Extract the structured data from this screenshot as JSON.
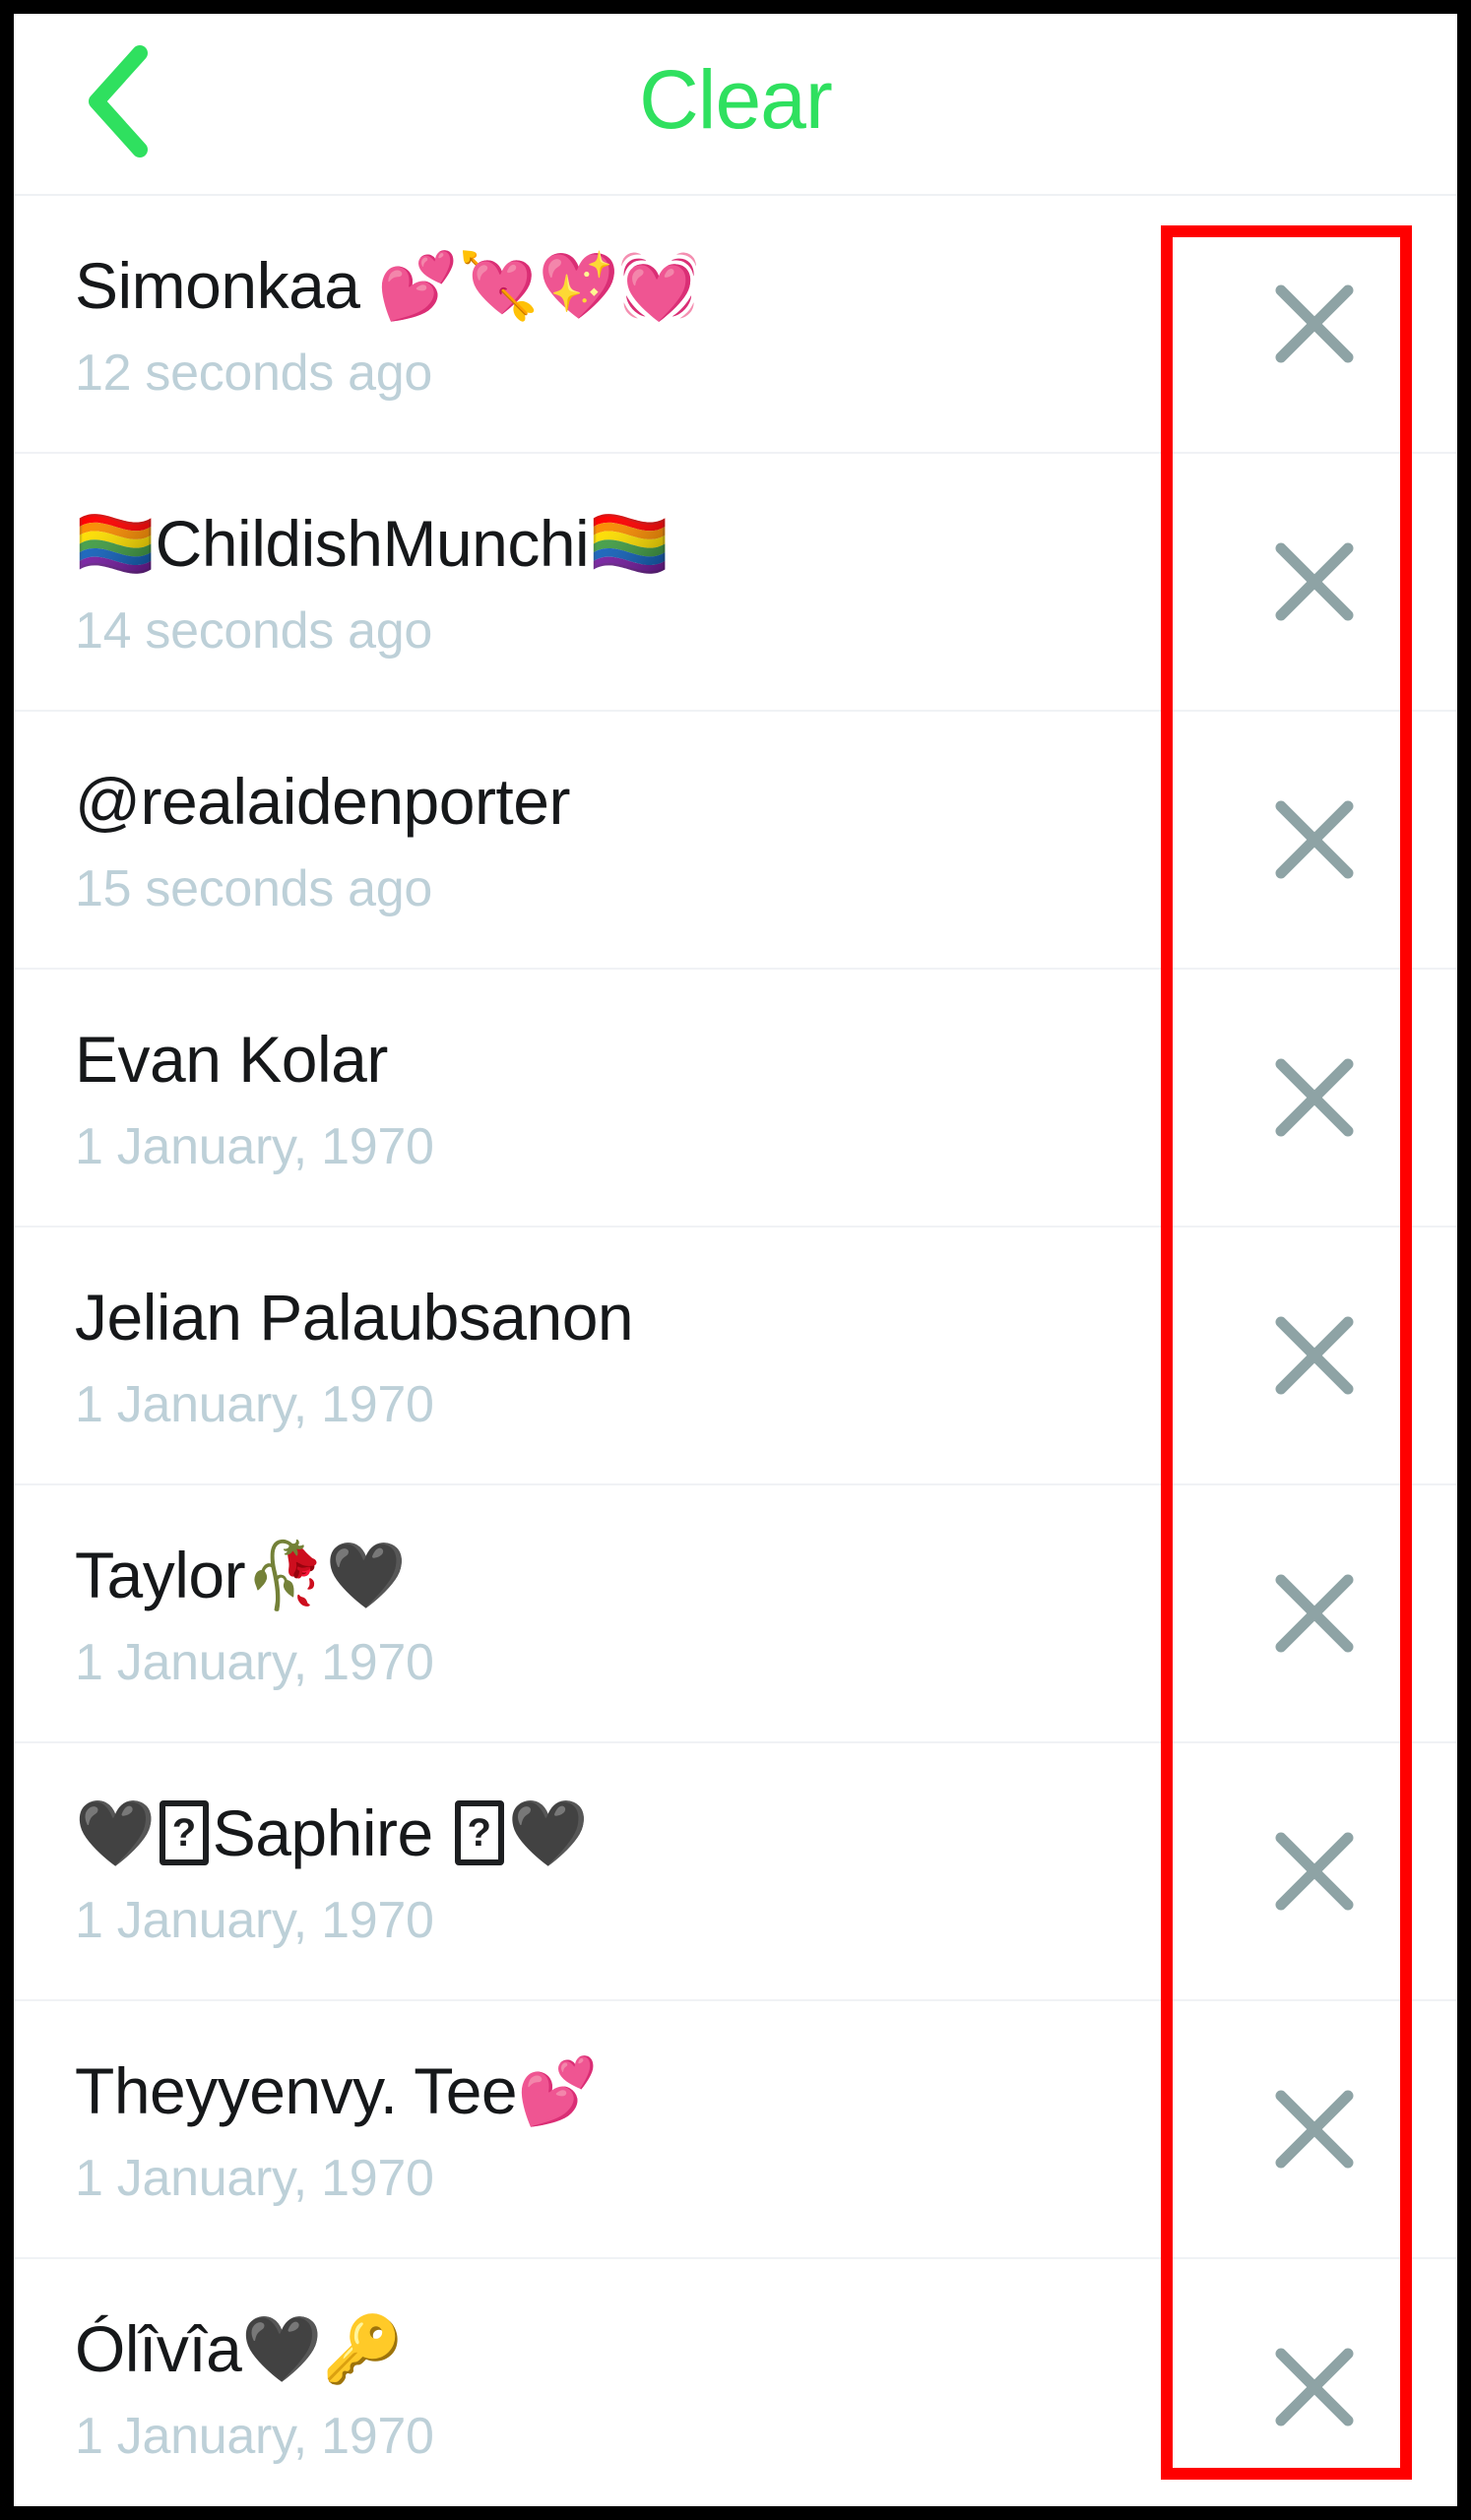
{
  "app": {
    "screen_title": "Clear",
    "accent_color": "#2fe05f",
    "annotation_color": "#ff0000",
    "close_icon_color": "#8ea3a5",
    "timestamp_color": "#bdd0d8",
    "name_color": "#16181a"
  },
  "nav": {
    "back_icon": "chevron-left-icon",
    "title": "Clear"
  },
  "annotation": {
    "name": "red-highlight-box",
    "target": "clear-buttons-column"
  },
  "list": {
    "close_icon": "close-x-icon",
    "rows": [
      {
        "name": "Simonkaa 💕💘💖💓",
        "time": "12 seconds ago",
        "has_tofu": false
      },
      {
        "name": "🏳️‍🌈ChildishMunchi🏳️‍🌈",
        "time": "14 seconds ago",
        "has_tofu": false
      },
      {
        "name": "@realaidenporter",
        "time": "15 seconds ago",
        "has_tofu": false
      },
      {
        "name": "Evan Kolar",
        "time": "1 January, 1970",
        "has_tofu": false
      },
      {
        "name": "Jelian Palaubsanon",
        "time": "1 January, 1970",
        "has_tofu": false
      },
      {
        "name": "Taylor🥀🖤",
        "time": "1 January, 1970",
        "has_tofu": false
      },
      {
        "name_parts": [
          "🖤",
          "TOFU",
          "Saphire ",
          "TOFU",
          "🖤"
        ],
        "name": "🖤⬜Saphire ⬜🖤",
        "time": "1 January, 1970",
        "has_tofu": true
      },
      {
        "name": "Theyyenvy. Tee💕",
        "time": "1 January, 1970",
        "has_tofu": false
      },
      {
        "name": "Ólîvîa🖤🔑",
        "time": "1 January, 1970",
        "has_tofu": false
      }
    ]
  }
}
